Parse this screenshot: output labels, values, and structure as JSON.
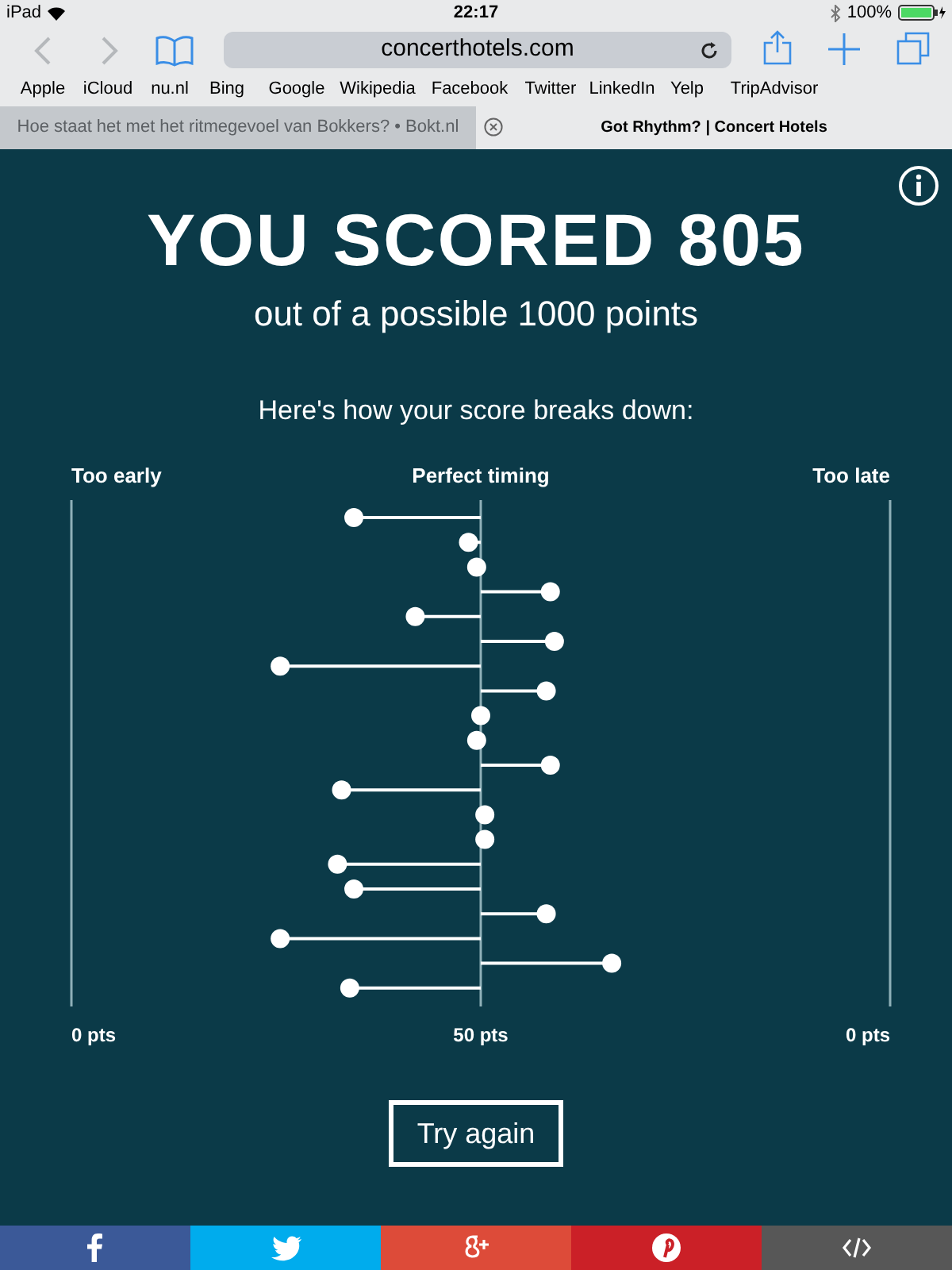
{
  "status_bar": {
    "device": "iPad",
    "time": "22:17",
    "battery": "100%"
  },
  "toolbar": {
    "url": "concerthotels.com"
  },
  "bookmarks": [
    "Apple",
    "iCloud",
    "nu.nl",
    "Bing",
    "Google",
    "Wikipedia",
    "Facebook",
    "Twitter",
    "LinkedIn",
    "Yelp",
    "TripAdvisor"
  ],
  "tabs": [
    {
      "title": "Hoe staat het met het ritmegevoel van Bokkers? • Bokt.nl",
      "selected": false
    },
    {
      "title": "Got Rhythm? | Concert Hotels",
      "selected": true
    }
  ],
  "page": {
    "score_title": "YOU SCORED 805",
    "subtitle": "out of a possible 1000 points",
    "breakdown_heading": "Here's how your score breaks down:",
    "chart_labels": [
      "Too early",
      "Perfect timing",
      "Too late"
    ],
    "tick_labels": [
      "0 pts",
      "50 pts",
      "0 pts"
    ],
    "button": "Try again"
  },
  "share_bar": [
    {
      "kind": "facebook",
      "color": "#3b5998"
    },
    {
      "kind": "twitter",
      "color": "#00aced"
    },
    {
      "kind": "googleplus",
      "color": "#dd4b39"
    },
    {
      "kind": "pinterest",
      "color": "#cb2027"
    },
    {
      "kind": "embed",
      "color": "#575757"
    }
  ]
}
